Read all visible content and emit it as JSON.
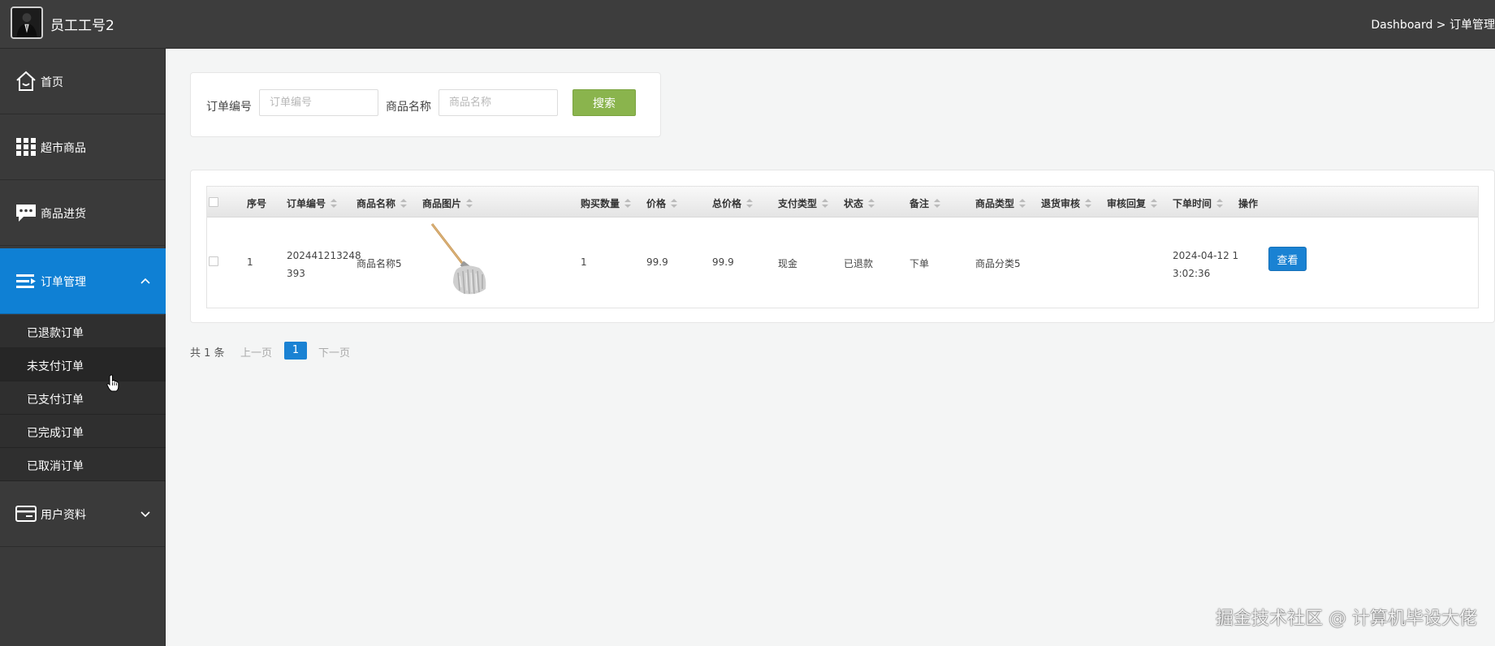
{
  "header": {
    "username": "员工工号2",
    "breadcrumb": "Dashboard > 订单管理"
  },
  "sidebar": {
    "items": [
      {
        "label": "首页",
        "icon": "home-icon"
      },
      {
        "label": "超市商品",
        "icon": "grid-icon"
      },
      {
        "label": "商品进货",
        "icon": "chat-icon"
      },
      {
        "label": "订单管理",
        "icon": "list-icon",
        "expanded": true
      },
      {
        "label": "用户资料",
        "icon": "card-icon",
        "expanded": false
      }
    ],
    "submenu": [
      {
        "label": "已退款订单"
      },
      {
        "label": "未支付订单"
      },
      {
        "label": "已支付订单"
      },
      {
        "label": "已完成订单"
      },
      {
        "label": "已取消订单"
      }
    ],
    "active_color": "#0f80d4"
  },
  "search": {
    "order_no_label": "订单编号",
    "order_no_placeholder": "订单编号",
    "product_name_label": "商品名称",
    "product_name_placeholder": "商品名称",
    "search_button": "搜索"
  },
  "table": {
    "columns": [
      "序号",
      "订单编号",
      "商品名称",
      "商品图片",
      "购买数量",
      "价格",
      "总价格",
      "支付类型",
      "状态",
      "备注",
      "商品类型",
      "退货审核",
      "审核回复",
      "下单时间",
      "操作"
    ],
    "rows": [
      {
        "index": "1",
        "order_no_line1": "202441213248",
        "order_no_line2": "393",
        "product_name": "商品名称5",
        "image": "mop-image",
        "quantity": "1",
        "price": "99.9",
        "total": "99.9",
        "pay_type": "现金",
        "status": "已退款",
        "remark": "下单",
        "category": "商品分类5",
        "return_review": "",
        "review_reply": "",
        "time_line1": "2024-04-12 1",
        "time_line2": "3:02:36",
        "action": "查看"
      }
    ]
  },
  "pagination": {
    "total": "共 1 条",
    "prev": "上一页",
    "current": "1",
    "next": "下一页"
  },
  "watermark": "掘金技术社区 @ 计算机毕设大佬",
  "colors": {
    "header_bg": "#3d3d3d",
    "sidebar_bg": "#3a3a3a",
    "search_button": "#8ab44d",
    "primary": "#1a82d3"
  }
}
